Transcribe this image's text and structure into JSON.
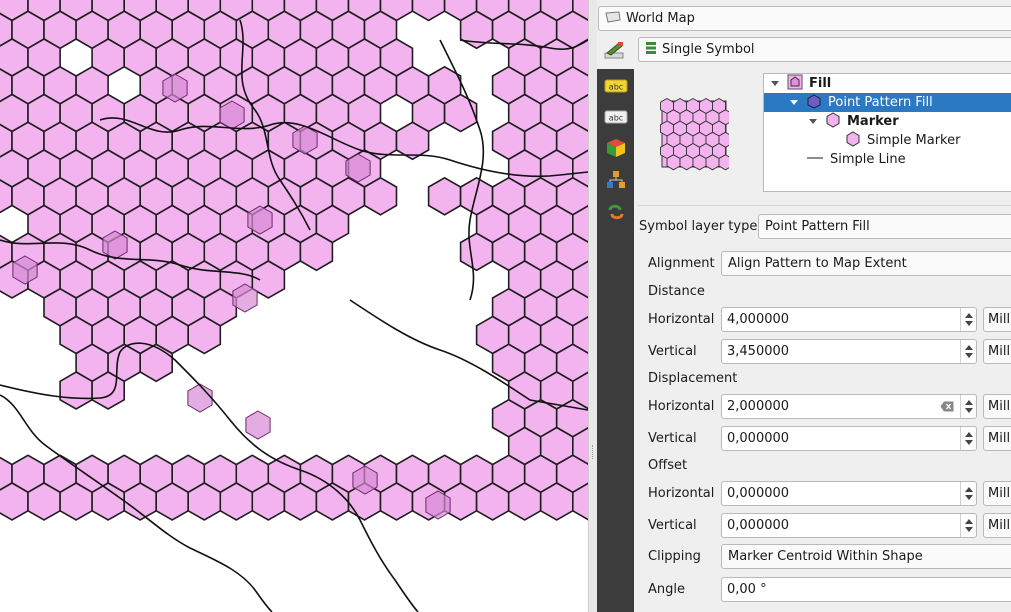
{
  "layer_selector": {
    "value": "World Map",
    "icon": "polygon-layer-icon"
  },
  "renderer_selector": {
    "value": "Single Symbol",
    "icon": "single-symbol-icon"
  },
  "side_tabs": [
    {
      "name": "symbology-tab-icon"
    },
    {
      "name": "labels-tab-icon"
    },
    {
      "name": "masks-tab-icon"
    },
    {
      "name": "3d-view-tab-icon"
    },
    {
      "name": "diagrams-tab-icon"
    },
    {
      "name": "history-tab-icon"
    }
  ],
  "symbol_tree": [
    {
      "label": "Fill",
      "bold": true,
      "level": 0,
      "expanded": true
    },
    {
      "label": "Point Pattern Fill",
      "bold": false,
      "level": 1,
      "expanded": true,
      "selected": true
    },
    {
      "label": "Marker",
      "bold": true,
      "level": 2,
      "expanded": true
    },
    {
      "label": "Simple Marker",
      "bold": false,
      "level": 3
    },
    {
      "label": "Simple Line",
      "bold": false,
      "level": 1
    }
  ],
  "form": {
    "symbol_layer_type_label": "Symbol layer type",
    "symbol_layer_type_value": "Point Pattern Fill",
    "alignment_label": "Alignment",
    "alignment_value": "Align Pattern to Map Extent",
    "distance_label": "Distance",
    "distance_h_label": "Horizontal",
    "distance_h_value": "4,000000",
    "distance_v_label": "Vertical",
    "distance_v_value": "3,450000",
    "displacement_label": "Displacement",
    "displacement_h_label": "Horizontal",
    "displacement_h_value": "2,000000",
    "displacement_v_label": "Vertical",
    "displacement_v_value": "0,000000",
    "offset_label": "Offset",
    "offset_h_label": "Horizontal",
    "offset_h_value": "0,000000",
    "offset_v_label": "Vertical",
    "offset_v_value": "0,000000",
    "clipping_label": "Clipping",
    "clipping_value": "Marker Centroid Within Shape",
    "angle_label": "Angle",
    "angle_value": "0,00 °",
    "unit_value": "Mill"
  },
  "colors": {
    "hex_fill": "#f2b3ee",
    "hex_fill_overlap": "#d98ad4",
    "hex_stroke": "#1e1e1e",
    "selected_row": "#2b79c2",
    "side_tab_bg": "#3c3c3c"
  }
}
